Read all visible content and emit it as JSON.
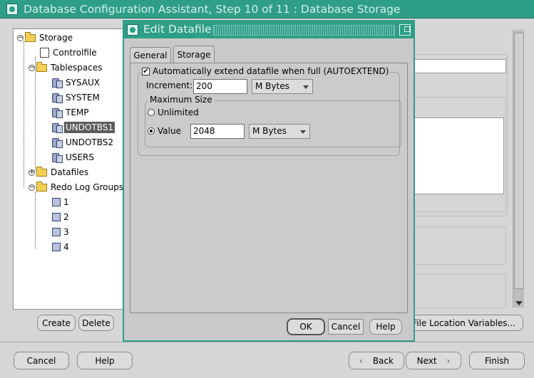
{
  "main_window": {
    "title": "Database Configuration Assistant, Step 10 of 11 : Database Storage"
  },
  "tree": {
    "root": "Storage",
    "items": [
      {
        "label": "Controlfile",
        "icon": "controlfile-icon"
      },
      {
        "label": "Tablespaces",
        "icon": "folder-icon"
      },
      {
        "label": "SYSAUX",
        "icon": "tablespace-icon"
      },
      {
        "label": "SYSTEM",
        "icon": "tablespace-icon"
      },
      {
        "label": "TEMP",
        "icon": "tablespace-icon"
      },
      {
        "label": "UNDOTBS1",
        "icon": "tablespace-icon",
        "selected": true
      },
      {
        "label": "UNDOTBS2",
        "icon": "tablespace-icon"
      },
      {
        "label": "USERS",
        "icon": "tablespace-icon"
      },
      {
        "label": "Datafiles",
        "icon": "folder-icon"
      },
      {
        "label": "Redo Log Groups",
        "icon": "folder-icon"
      },
      {
        "label": "1",
        "icon": "redo-log-icon"
      },
      {
        "label": "2",
        "icon": "redo-log-icon"
      },
      {
        "label": "3",
        "icon": "redo-log-icon"
      },
      {
        "label": "4",
        "icon": "redo-log-icon"
      }
    ]
  },
  "main_buttons": {
    "create": "Create",
    "delete": "Delete",
    "file_location": "File Location Variables...",
    "cancel": "Cancel",
    "help": "Help",
    "back": "Back",
    "next": "Next",
    "finish": "Finish"
  },
  "dialog": {
    "title": "Edit Datafile",
    "tabs": [
      "General",
      "Storage"
    ],
    "active_tab": "Storage",
    "autoextend_label": "Automatically extend datafile when full (AUTOEXTEND)",
    "autoextend_checked": true,
    "increment_label": "Increment:",
    "increment_value": "200",
    "increment_unit": "M Bytes",
    "max_size_group": "Maximum Size",
    "unlimited_label": "Unlimited",
    "value_label": "Value",
    "value_selected": true,
    "max_value": "2048",
    "max_unit": "M Bytes",
    "ok": "OK",
    "cancel": "Cancel",
    "help": "Help"
  },
  "colors": {
    "title_bar": "#2e9e88",
    "selection": "#5b5b5b",
    "window_bg": "#d6d6d6"
  }
}
